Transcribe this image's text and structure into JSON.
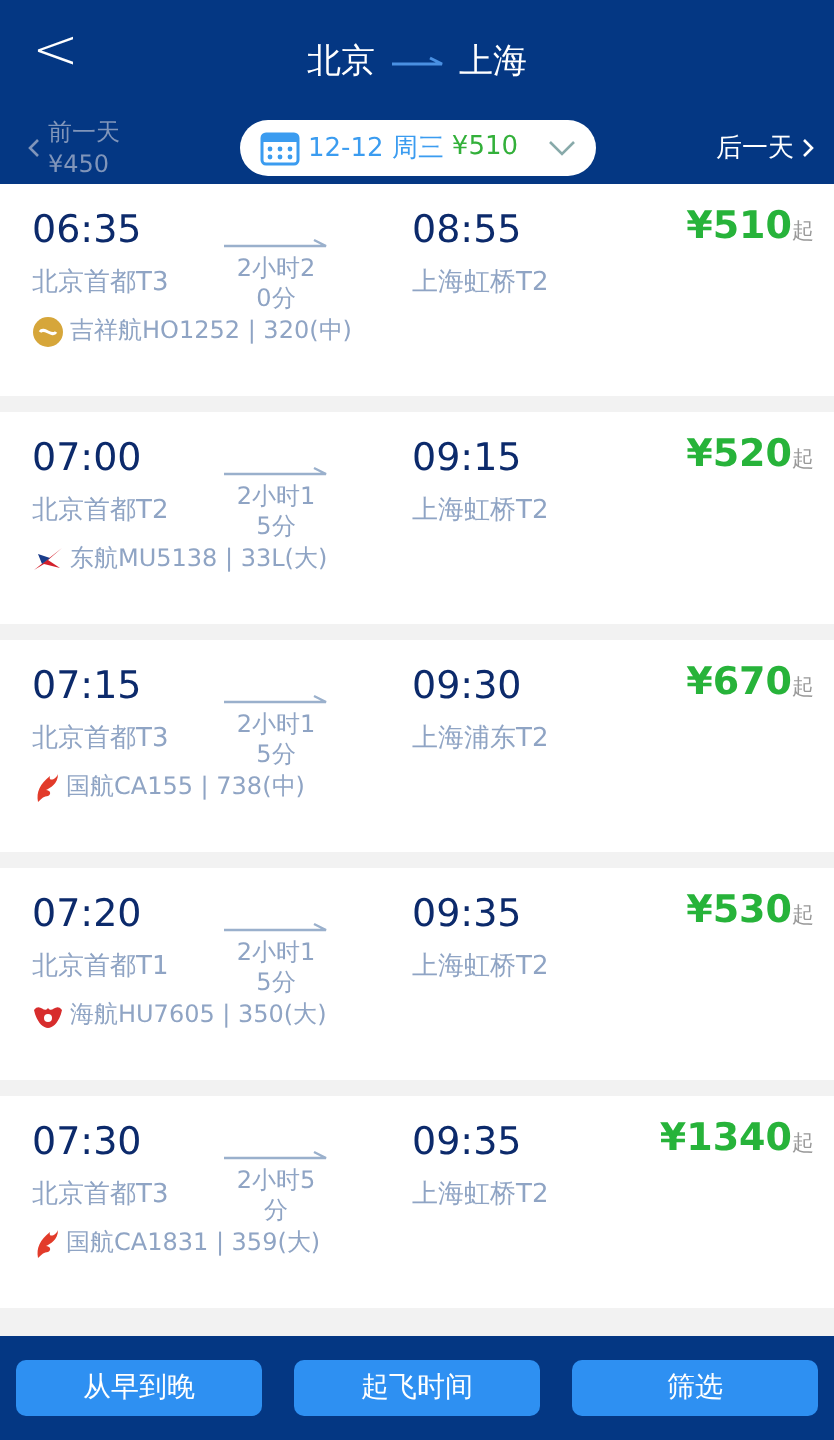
{
  "header": {
    "back": "<",
    "from": "北京",
    "to": "上海"
  },
  "date_bar": {
    "prev_label": "前一天",
    "prev_price": "¥450",
    "date": "12-12 周三",
    "price": "¥510",
    "next_label": "后一天"
  },
  "flights": [
    {
      "dep_time": "06:35",
      "dep_airport": "北京首都T3",
      "duration": "2小时20分",
      "arr_time": "08:55",
      "arr_airport": "上海虹桥T2",
      "price": "¥510",
      "price_suffix": "起",
      "airline": "吉祥航HO1252 | 320(中)",
      "kind": "juneyao"
    },
    {
      "dep_time": "07:00",
      "dep_airport": "北京首都T2",
      "duration": "2小时15分",
      "arr_time": "09:15",
      "arr_airport": "上海虹桥T2",
      "price": "¥520",
      "price_suffix": "起",
      "airline": "东航MU5138 | 33L(大)",
      "kind": "eastern"
    },
    {
      "dep_time": "07:15",
      "dep_airport": "北京首都T3",
      "duration": "2小时15分",
      "arr_time": "09:30",
      "arr_airport": "上海浦东T2",
      "price": "¥670",
      "price_suffix": "起",
      "airline": "国航CA155 | 738(中)",
      "kind": "airchina"
    },
    {
      "dep_time": "07:20",
      "dep_airport": "北京首都T1",
      "duration": "2小时15分",
      "arr_time": "09:35",
      "arr_airport": "上海虹桥T2",
      "price": "¥530",
      "price_suffix": "起",
      "airline": "海航HU7605 | 350(大)",
      "kind": "hainan"
    },
    {
      "dep_time": "07:30",
      "dep_airport": "北京首都T3",
      "duration": "2小时5分",
      "arr_time": "09:35",
      "arr_airport": "上海虹桥T2",
      "price": "¥1340",
      "price_suffix": "起",
      "airline": "国航CA1831 | 359(大)",
      "kind": "airchina"
    }
  ],
  "buttons": [
    "从早到晚",
    "起飞时间",
    "筛选"
  ]
}
